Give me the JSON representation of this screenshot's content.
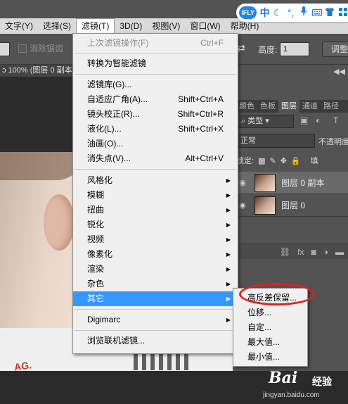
{
  "menubar": {
    "items": [
      {
        "label": "文字(Y)"
      },
      {
        "label": "选择(S)"
      },
      {
        "label": "滤镜(T)"
      },
      {
        "label": "3D(D)"
      },
      {
        "label": "视图(V)"
      },
      {
        "label": "窗口(W)"
      },
      {
        "label": "帮助(H)"
      }
    ]
  },
  "ifly": {
    "logo": "iFLY",
    "zh": "中",
    "icons": [
      "moon-icon",
      "comma-icon",
      "microphone-icon",
      "keyboard-icon",
      "shirt-icon",
      "grid-icon"
    ]
  },
  "options": {
    "antialias_label": "消除锯齿",
    "height_label": "高度:",
    "height_value": "1",
    "adjust_label": "调整"
  },
  "document": {
    "tab_label": "ɔ 100% (图层 0 副本"
  },
  "filter_menu": {
    "last_filter": {
      "label": "上次滤镜操作(F)",
      "shortcut": "Ctrl+F"
    },
    "smart": {
      "label": "转换为智能滤镜"
    },
    "gallery": {
      "label": "滤镜库(G)..."
    },
    "adaptive_wide": {
      "label": "自适应广角(A)...",
      "shortcut": "Shift+Ctrl+A"
    },
    "lens_correction": {
      "label": "镜头校正(R)...",
      "shortcut": "Shift+Ctrl+R"
    },
    "liquify": {
      "label": "液化(L)...",
      "shortcut": "Shift+Ctrl+X"
    },
    "oil_paint": {
      "label": "油画(O)..."
    },
    "vanishing_point": {
      "label": "消失点(V)...",
      "shortcut": "Alt+Ctrl+V"
    },
    "categories": [
      {
        "label": "风格化"
      },
      {
        "label": "模糊"
      },
      {
        "label": "扭曲"
      },
      {
        "label": "锐化"
      },
      {
        "label": "视频"
      },
      {
        "label": "像素化"
      },
      {
        "label": "渲染"
      },
      {
        "label": "杂色"
      },
      {
        "label": "其它"
      }
    ],
    "digimarc": {
      "label": "Digimarc"
    },
    "browse": {
      "label": "浏览联机滤镜..."
    }
  },
  "submenu": {
    "items": [
      {
        "label": "高反差保留..."
      },
      {
        "label": "位移..."
      },
      {
        "label": "自定..."
      },
      {
        "label": "最大值..."
      },
      {
        "label": "最小值..."
      }
    ]
  },
  "layers_panel": {
    "tabs": [
      {
        "label": "颜色"
      },
      {
        "label": "色板"
      },
      {
        "label": "图层"
      },
      {
        "label": "通道"
      },
      {
        "label": "路径"
      }
    ],
    "kind_label": "类型",
    "blend_mode": "正常",
    "opacity_label": "不透明度",
    "lock_label": "锁定:",
    "fill_label": "填",
    "layers": [
      {
        "name": "图层 0 副本"
      },
      {
        "name": "图层 0"
      }
    ]
  },
  "photo": {
    "shirt_text": "AG."
  },
  "watermark": {
    "logo": "Bai",
    "brand": "经验",
    "url": "jingyan.baidu.com"
  },
  "colors": {
    "menu_highlight": "#3399ff",
    "annotation_ring": "#e02020",
    "ifly_blue": "#1e88e5"
  }
}
